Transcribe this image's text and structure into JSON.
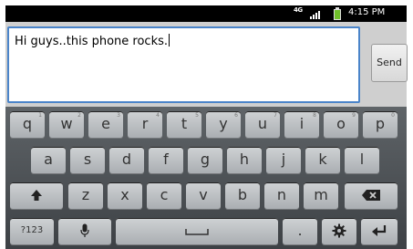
{
  "status_bar": {
    "network": "4G",
    "time": "4:15 PM"
  },
  "message": {
    "text": "Hi guys..this phone rocks."
  },
  "send_label": "Send",
  "keyboard": {
    "row1": [
      {
        "label": "q",
        "sub": "1"
      },
      {
        "label": "w",
        "sub": "2"
      },
      {
        "label": "e",
        "sub": "3"
      },
      {
        "label": "r",
        "sub": "4"
      },
      {
        "label": "t",
        "sub": "5"
      },
      {
        "label": "y",
        "sub": "6"
      },
      {
        "label": "u",
        "sub": "7"
      },
      {
        "label": "i",
        "sub": "8"
      },
      {
        "label": "o",
        "sub": "9"
      },
      {
        "label": "p",
        "sub": "0"
      }
    ],
    "row2": [
      "a",
      "s",
      "d",
      "f",
      "g",
      "h",
      "j",
      "k",
      "l"
    ],
    "row3": [
      "z",
      "x",
      "c",
      "v",
      "b",
      "n",
      "m"
    ],
    "mode_label": "?123",
    "period_label": "."
  }
}
